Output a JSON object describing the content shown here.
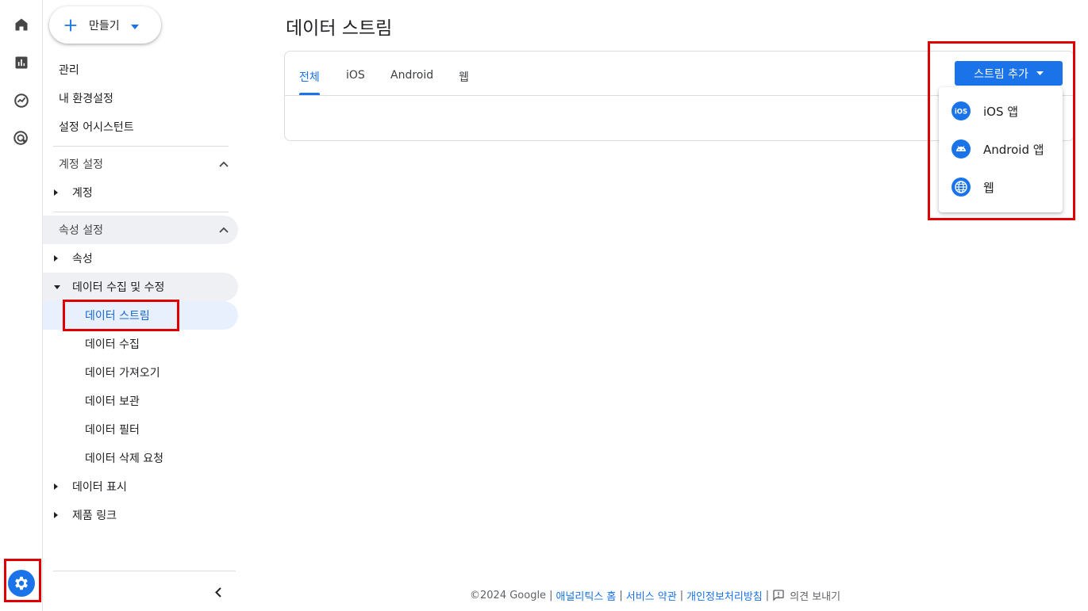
{
  "rail": {
    "icons": [
      "home-icon",
      "reports-icon",
      "explore-icon",
      "advertising-icon"
    ],
    "settings_icon": "gear-icon"
  },
  "sidenav": {
    "create_label": "만들기",
    "top_items": [
      "관리",
      "내 환경설정",
      "설정 어시스턴트"
    ],
    "account_section": {
      "label": "계정 설정",
      "items": [
        "계정"
      ]
    },
    "property_section": {
      "label": "속성 설정",
      "property_item": "속성",
      "data_collection": {
        "label": "데이터 수집 및 수정",
        "children": [
          "데이터 스트림",
          "데이터 수집",
          "데이터 가져오기",
          "데이터 보관",
          "데이터 필터",
          "데이터 삭제 요청"
        ]
      },
      "data_display": "데이터 표시",
      "product_links": "제품 링크"
    }
  },
  "main": {
    "title": "데이터 스트림",
    "tabs": [
      "전체",
      "iOS",
      "Android",
      "웹"
    ],
    "active_tab": "전체",
    "add_stream_label": "스트림 추가",
    "menu": [
      {
        "label": "iOS 앱",
        "icon": "ios-icon"
      },
      {
        "label": "Android 앱",
        "icon": "android-icon"
      },
      {
        "label": "웹",
        "icon": "globe-icon"
      }
    ]
  },
  "footer": {
    "copyright": "©2024 Google",
    "links": [
      "애널리틱스 홈",
      "서비스 약관",
      "개인정보처리방침"
    ],
    "feedback_label": "의견 보내기"
  },
  "colors": {
    "accent": "#1a73e8",
    "highlight_box": "#e00000",
    "selected_bg": "#e8f0fe"
  }
}
